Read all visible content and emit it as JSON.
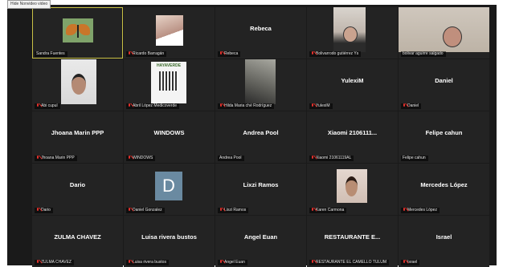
{
  "controls": {
    "hide_non_video": "Hide Nonvideo video"
  },
  "tiles": [
    {
      "label": "Sandra Fuentes",
      "center": "",
      "muted": false,
      "media": "butterfly"
    },
    {
      "label": "Ricardo Barragán",
      "center": "",
      "muted": true,
      "media": "ricardo"
    },
    {
      "label": "Rebeca",
      "center": "Rebeca",
      "muted": true,
      "media": ""
    },
    {
      "label": "Bolivarrodo gutiérrez Ys",
      "center": "",
      "muted": true,
      "media": "boli"
    },
    {
      "label": "bolivar aguirre salgado",
      "center": "",
      "muted": false,
      "media": "bolivar"
    },
    {
      "label": "Abi cupul",
      "center": "",
      "muted": true,
      "media": "abi"
    },
    {
      "label": "Abril López Medicoverde",
      "center": "",
      "muted": true,
      "media": "qr"
    },
    {
      "label": "Hilda Maria ché Rodríguez",
      "center": "",
      "muted": true,
      "media": "hilda"
    },
    {
      "label": "YulexiM",
      "center": "YulexiM",
      "muted": true,
      "media": ""
    },
    {
      "label": "Daniel",
      "center": "Daniel",
      "muted": true,
      "media": ""
    },
    {
      "label": "Jhoana Marin PPP",
      "center": "Jhoana Marin PPP",
      "muted": true,
      "media": ""
    },
    {
      "label": "WINDOWS",
      "center": "WINDOWS",
      "muted": true,
      "media": ""
    },
    {
      "label": "Andrea Pool",
      "center": "Andrea Pool",
      "muted": false,
      "media": ""
    },
    {
      "label": "Xiaomi 21061119AL",
      "center": "Xiaomi 2106111...",
      "muted": true,
      "media": ""
    },
    {
      "label": "Felipe cahun",
      "center": "Felipe cahun",
      "muted": false,
      "media": ""
    },
    {
      "label": "Dario",
      "center": "Dario",
      "muted": true,
      "media": ""
    },
    {
      "label": "Daniel Gonzalez",
      "center": "",
      "muted": true,
      "media": "davatar"
    },
    {
      "label": "Lixzi Ramos",
      "center": "Lixzi Ramos",
      "muted": true,
      "media": ""
    },
    {
      "label": "Karen Carmona",
      "center": "",
      "muted": true,
      "media": "karen"
    },
    {
      "label": "Mercedes López",
      "center": "Mercedes López",
      "muted": true,
      "media": ""
    },
    {
      "label": "ZULMA CHAVEZ",
      "center": "ZULMA CHAVEZ",
      "muted": true,
      "media": ""
    },
    {
      "label": "Luisa rivera bustos",
      "center": "Luisa rivera bustos",
      "muted": true,
      "media": ""
    },
    {
      "label": "Angel Euan",
      "center": "Angel Euan",
      "muted": true,
      "media": ""
    },
    {
      "label": "RESTAURANTE EL CAMELLO TULUM",
      "center": "RESTAURANTE E...",
      "muted": true,
      "media": ""
    },
    {
      "label": "Israel",
      "center": "Israel",
      "muted": true,
      "media": ""
    }
  ],
  "qr_brand": "HAYAVERDE",
  "avatar_letter": "D"
}
